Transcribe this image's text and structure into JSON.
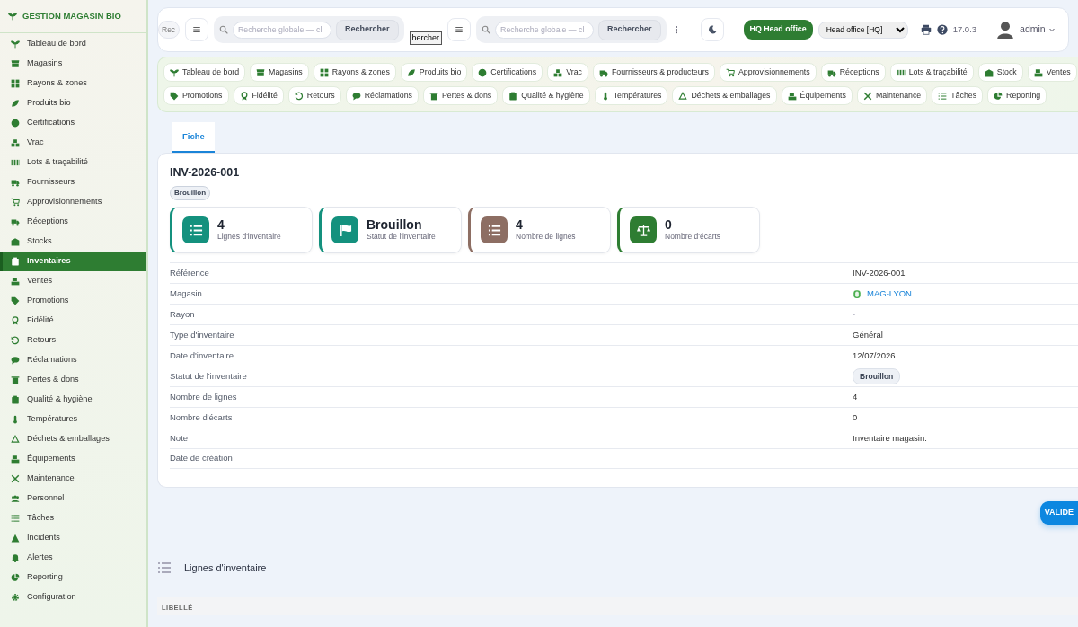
{
  "sidebar": {
    "title": "GESTION MAGASIN BIO",
    "items": [
      {
        "label": "Tableau de bord",
        "selected": false
      },
      {
        "label": "Magasins",
        "selected": false
      },
      {
        "label": "Rayons & zones",
        "selected": false
      },
      {
        "label": "Produits bio",
        "selected": false
      },
      {
        "label": "Certifications",
        "selected": false
      },
      {
        "label": "Vrac",
        "selected": false
      },
      {
        "label": "Lots & traçabilité",
        "selected": false
      },
      {
        "label": "Fournisseurs",
        "selected": false
      },
      {
        "label": "Approvisionnements",
        "selected": false
      },
      {
        "label": "Réceptions",
        "selected": false
      },
      {
        "label": "Stocks",
        "selected": false
      },
      {
        "label": "Inventaires",
        "selected": true
      },
      {
        "label": "Ventes",
        "selected": false
      },
      {
        "label": "Promotions",
        "selected": false
      },
      {
        "label": "Fidélité",
        "selected": false
      },
      {
        "label": "Retours",
        "selected": false
      },
      {
        "label": "Réclamations",
        "selected": false
      },
      {
        "label": "Pertes & dons",
        "selected": false
      },
      {
        "label": "Qualité & hygiène",
        "selected": false
      },
      {
        "label": "Températures",
        "selected": false
      },
      {
        "label": "Déchets & emballages",
        "selected": false
      },
      {
        "label": "Équipements",
        "selected": false
      },
      {
        "label": "Maintenance",
        "selected": false
      },
      {
        "label": "Personnel",
        "selected": false
      },
      {
        "label": "Tâches",
        "selected": false
      },
      {
        "label": "Incidents",
        "selected": false
      },
      {
        "label": "Alertes",
        "selected": false
      },
      {
        "label": "Reporting",
        "selected": false
      },
      {
        "label": "Configuration",
        "selected": false
      }
    ]
  },
  "topbar": {
    "fragment_field": {
      "placeholder": "Rec"
    },
    "searches": [
      {
        "placeholder": "Recherche globale — cl",
        "button": "Rechercher"
      },
      {
        "placeholder": "Recherche globale — cl",
        "button": "Rechercher"
      }
    ],
    "fragment_button": "hercher",
    "office_badge": "HQ Head office",
    "office_select": "Head office [HQ]",
    "version": "17.0.3",
    "user": "admin"
  },
  "quick_nav": {
    "items": [
      "Tableau de bord",
      "Magasins",
      "Rayons & zones",
      "Produits bio",
      "Certifications",
      "Vrac",
      "Fournisseurs & producteurs",
      "Approvisionnements",
      "Réceptions",
      "Lots & traçabilité",
      "Stock",
      "Ventes",
      "Promotions",
      "Fidélité",
      "Retours",
      "Réclamations",
      "Pertes & dons",
      "Qualité & hygiène",
      "Températures",
      "Déchets & emballages",
      "Équipements",
      "Maintenance",
      "Tâches",
      "Reporting"
    ]
  },
  "tabs": [
    {
      "label": "Fiche",
      "selected": true
    }
  ],
  "record": {
    "title": "INV-2026-001",
    "status_badge": "Brouillon",
    "stats": [
      {
        "value": "4",
        "label": "Lignes d'inventaire",
        "color": "#14917e"
      },
      {
        "value": "Brouillon",
        "label": "Statut de l'inventaire",
        "color": "#14917e"
      },
      {
        "value": "4",
        "label": "Nombre de lignes",
        "color": "#8d6e63"
      },
      {
        "value": "0",
        "label": "Nombre d'écarts",
        "color": "#2e7d32"
      }
    ],
    "fields": [
      {
        "label": "Référence",
        "value": "INV-2026-001",
        "kind": "text"
      },
      {
        "label": "Magasin",
        "value": "MAG-LYON",
        "kind": "link"
      },
      {
        "label": "Rayon",
        "value": "-",
        "kind": "muted"
      },
      {
        "label": "Type d'inventaire",
        "value": "Général",
        "kind": "text"
      },
      {
        "label": "Date d'inventaire",
        "value": "12/07/2026",
        "kind": "text"
      },
      {
        "label": "Statut de l'inventaire",
        "value": "Brouillon",
        "kind": "badge"
      },
      {
        "label": "Nombre de lignes",
        "value": "4",
        "kind": "text"
      },
      {
        "label": "Nombre d'écarts",
        "value": "0",
        "kind": "text"
      },
      {
        "label": "Note",
        "value": "Inventaire magasin.",
        "kind": "text"
      },
      {
        "label": "Date de création"
      }
    ]
  },
  "validate_button": "VALIDE",
  "lines_section": {
    "title": "Lignes d'inventaire",
    "columns": [
      "LIBELLÉ"
    ]
  }
}
